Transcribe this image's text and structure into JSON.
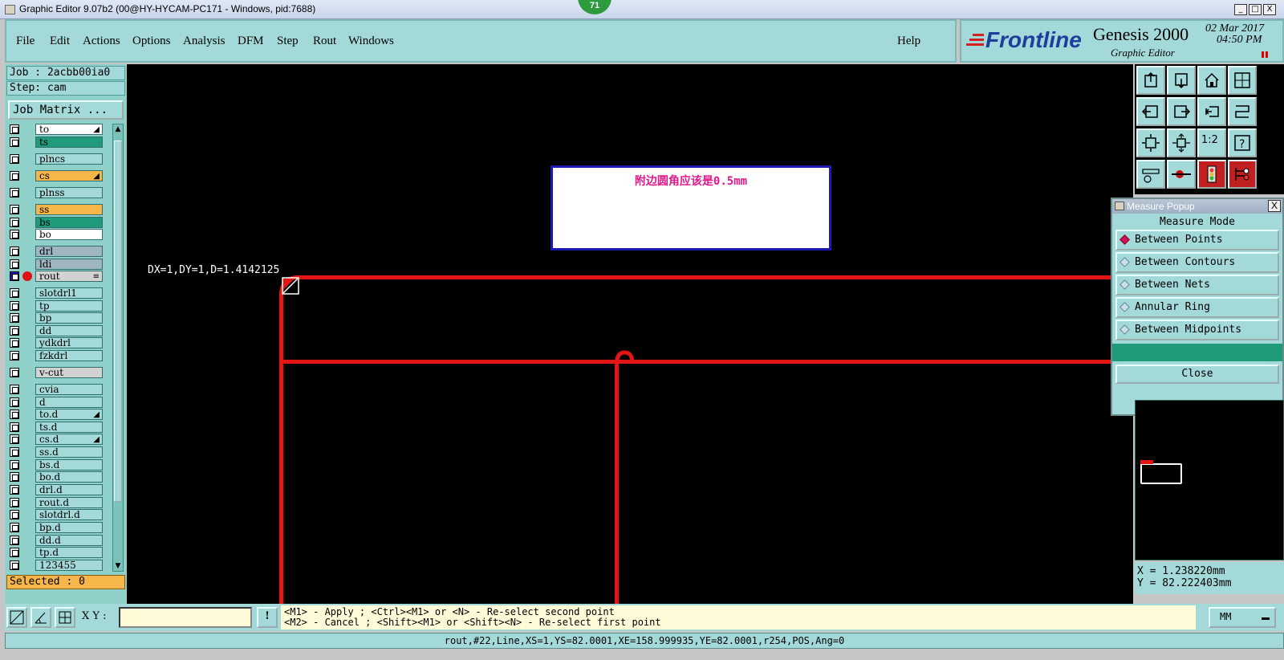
{
  "titlebar": {
    "title": "Graphic Editor 9.07b2 (00@HY-HYCAM-PC171 - Windows, pid:7688)",
    "badge": "71",
    "min": "_",
    "max": "□",
    "close": "X"
  },
  "menu": {
    "items": [
      "File",
      "Edit",
      "Actions",
      "Options",
      "Analysis",
      "DFM",
      "Step",
      "Rout",
      "Windows"
    ],
    "help": "Help"
  },
  "logo": {
    "brand": "Frontline",
    "product": "Genesis 2000",
    "subtitle": "Graphic Editor",
    "date": "02 Mar 2017",
    "time": "04:50 PM"
  },
  "left": {
    "job": "Job : 2acbb00ia0",
    "step": "Step: cam",
    "job_matrix": "Job Matrix ...",
    "selected": "Selected : 0",
    "layers": [
      {
        "name": "to",
        "color": "#ffffff",
        "mark": "◢"
      },
      {
        "name": "ts",
        "color": "#1f9a7a",
        "mark": ""
      },
      {
        "name": "plncs",
        "color": "#a3d9d9",
        "mark": ""
      },
      {
        "name": "cs",
        "color": "#f7b64a",
        "mark": "◢"
      },
      {
        "name": "plnss",
        "color": "#a3d9d9",
        "mark": ""
      },
      {
        "name": "ss",
        "color": "#f7b64a",
        "mark": ""
      },
      {
        "name": "bs",
        "color": "#1f9a7a",
        "mark": ""
      },
      {
        "name": "bo",
        "color": "#ffffff",
        "mark": ""
      },
      {
        "name": "drl",
        "color": "#9fb6bf",
        "mark": ""
      },
      {
        "name": "ldi",
        "color": "#9fb6bf",
        "mark": ""
      },
      {
        "name": "rout",
        "color": "#d3d3d3",
        "mark": "≡",
        "active": true
      },
      {
        "name": "slotdrl1",
        "color": "#a3d9d9",
        "mark": ""
      },
      {
        "name": "tp",
        "color": "#a3d9d9",
        "mark": ""
      },
      {
        "name": "bp",
        "color": "#a3d9d9",
        "mark": ""
      },
      {
        "name": "dd",
        "color": "#a3d9d9",
        "mark": ""
      },
      {
        "name": "ydkdrl",
        "color": "#a3d9d9",
        "mark": ""
      },
      {
        "name": "fzkdrl",
        "color": "#a3d9d9",
        "mark": ""
      },
      {
        "name": "v-cut",
        "color": "#d3d3d3",
        "mark": ""
      },
      {
        "name": "cvia",
        "color": "#a3d9d9",
        "mark": ""
      },
      {
        "name": "d",
        "color": "#a3d9d9",
        "mark": ""
      },
      {
        "name": "to.d",
        "color": "#a3d9d9",
        "mark": "◢"
      },
      {
        "name": "ts.d",
        "color": "#a3d9d9",
        "mark": ""
      },
      {
        "name": "cs.d",
        "color": "#a3d9d9",
        "mark": "◢"
      },
      {
        "name": "ss.d",
        "color": "#a3d9d9",
        "mark": ""
      },
      {
        "name": "bs.d",
        "color": "#a3d9d9",
        "mark": ""
      },
      {
        "name": "bo.d",
        "color": "#a3d9d9",
        "mark": ""
      },
      {
        "name": "drl.d",
        "color": "#a3d9d9",
        "mark": ""
      },
      {
        "name": "rout.d",
        "color": "#a3d9d9",
        "mark": ""
      },
      {
        "name": "slotdrl.d",
        "color": "#a3d9d9",
        "mark": ""
      },
      {
        "name": "bp.d",
        "color": "#a3d9d9",
        "mark": ""
      },
      {
        "name": "dd.d",
        "color": "#a3d9d9",
        "mark": ""
      },
      {
        "name": "tp.d",
        "color": "#a3d9d9",
        "mark": ""
      },
      {
        "name": "123455",
        "color": "#a3d9d9",
        "mark": ""
      }
    ]
  },
  "canvas": {
    "measure_readout": "DX=1,DY=1,D=1.4142125",
    "note": "附边圆角应该是0.5mm"
  },
  "popup": {
    "title": "Measure Popup",
    "mode_label": "Measure Mode",
    "options": [
      "Between Points",
      "Between Contours",
      "Between Nets",
      "Annular Ring",
      "Between Midpoints"
    ],
    "selected_option": "Between Points",
    "close": "Close",
    "x_btn": "X"
  },
  "coords": {
    "x": "X = 1.238220mm",
    "y": "Y = 82.222403mm"
  },
  "bottom": {
    "xy_label": "X Y :",
    "xy_value": "",
    "bang": "!",
    "hint1": "<M1> - Apply ; <Ctrl><M1> or <N> - Re-select second point",
    "hint2": "<M2> - Cancel ; <Shift><M1> or <Shift><N> - Re-select first point",
    "units": "MM",
    "status": "rout,#22,Line,XS=1,YS=82.0001,XE=158.999935,YE=82.0001,r254,POS,Ang=0"
  }
}
